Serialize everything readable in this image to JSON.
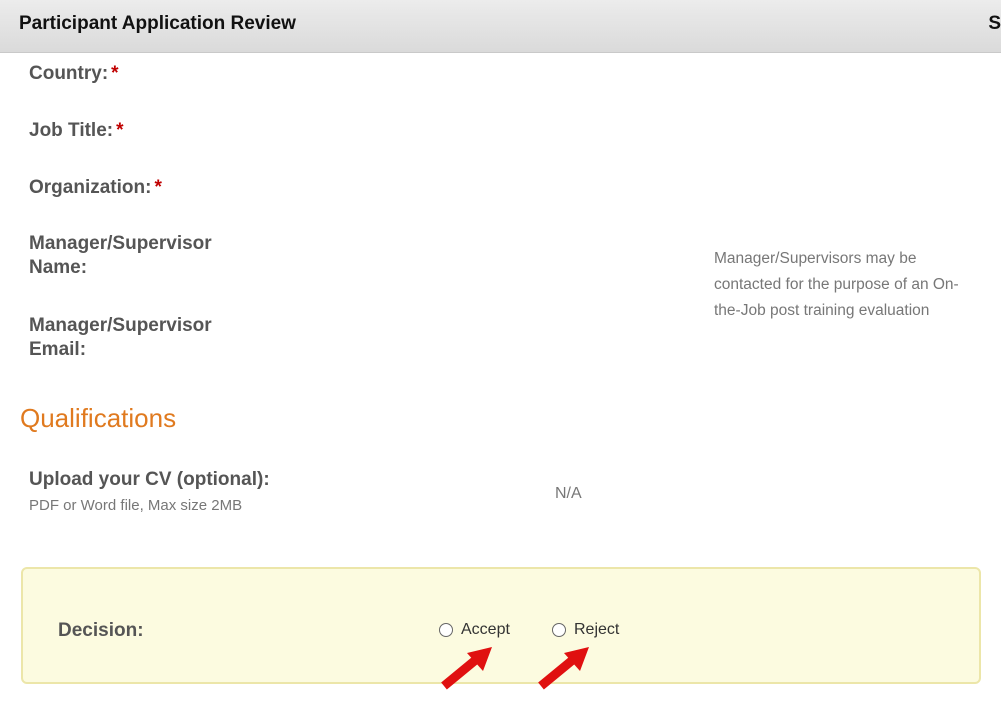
{
  "header": {
    "title": "Participant Application Review",
    "right_glyph": "S"
  },
  "fields": {
    "country_label": "Country:",
    "job_title_label": "Job Title:",
    "organization_label": "Organization:",
    "required_mark": "*",
    "manager_name_label_line1": "Manager/Supervisor",
    "manager_name_label_line2": "Name:",
    "manager_email_label_line1": "Manager/Supervisor",
    "manager_email_label_line2": "Email:",
    "manager_note": "Manager/Supervisors may be contacted for the purpose of an On-the-Job post training evaluation"
  },
  "qualifications": {
    "section_title": "Qualifications",
    "cv_label": "Upload your CV (optional):",
    "cv_hint": "PDF or Word file, Max size 2MB",
    "cv_value": "N/A"
  },
  "decision": {
    "label": "Decision:",
    "options": [
      "Accept",
      "Reject"
    ],
    "selected": null
  },
  "colors": {
    "section_title": "#e07a1f",
    "required_mark": "#c00000",
    "decision_box_bg": "#fcfbe0",
    "decision_box_border": "#ece6a9",
    "annotation_arrow": "#e01010"
  },
  "annotations": {
    "arrow_icon": "red-arrow-icon"
  }
}
